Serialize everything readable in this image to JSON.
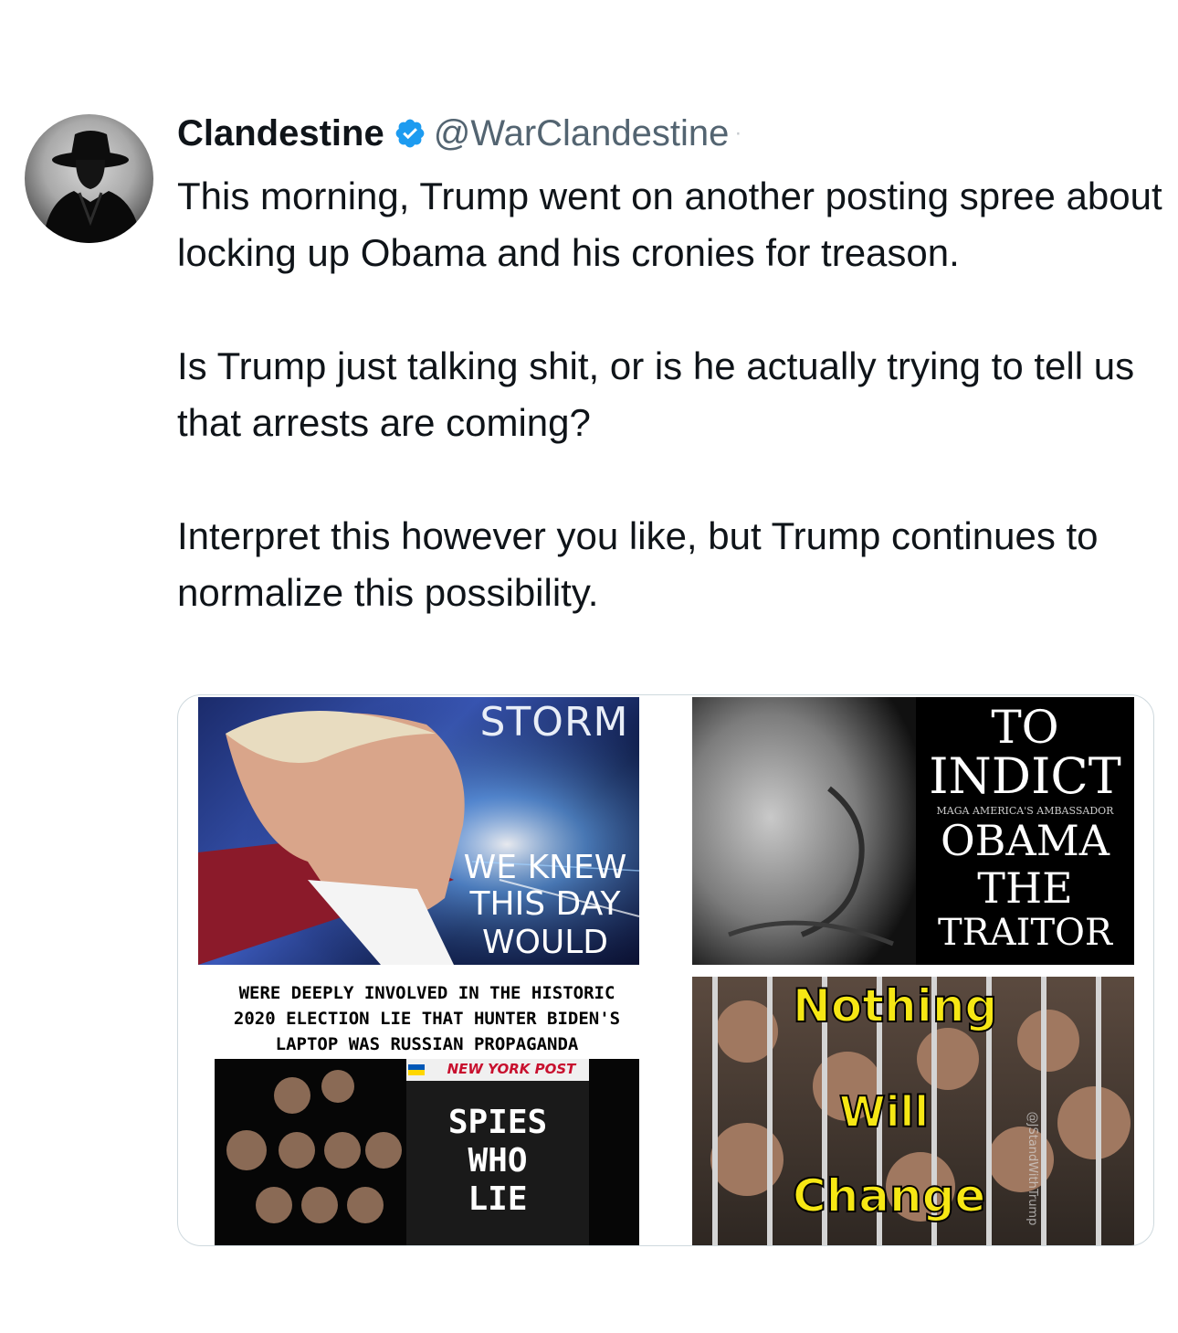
{
  "tweet": {
    "display_name": "Clandestine",
    "handle": "@WarClandestine",
    "separator": "·",
    "paragraphs": [
      "This morning, Trump went on another posting spree about locking up Obama and his cronies for treason.",
      "Is Trump just talking shit, or is he actually trying to tell us that arrests are coming?",
      "Interpret this however you like, but Trump continues to normalize this possibility."
    ]
  },
  "media": {
    "panel1": {
      "title": "STORM",
      "caption_1": "WE KNEW",
      "caption_2": "THIS DAY",
      "caption_3": "WOULD"
    },
    "panel2": {
      "line_1": "TO",
      "line_2": "INDICT",
      "small": "MAGA AMERICA'S AMBASSADOR",
      "line_3": "OBAMA",
      "line_4": "THE",
      "line_5": "TRAITOR"
    },
    "panel3": {
      "header_1": "WERE DEEPLY INVOLVED IN THE HISTORIC",
      "header_2": "2020 ELECTION LIE THAT HUNTER BIDEN'S",
      "header_3": "LAPTOP WAS RUSSIAN PROPAGANDA",
      "masthead": "NEW YORK POST",
      "headline_1": "SPIES",
      "headline_2": "WHO",
      "headline_3": "LIE"
    },
    "panel4": {
      "line_1": "Nothing",
      "line_2": "Will",
      "line_3": "Change",
      "watermark": "@JStandWithTrump"
    }
  },
  "colors": {
    "verified": "#1d9bf0",
    "handle": "#536471",
    "yellow": "#f6e714"
  }
}
